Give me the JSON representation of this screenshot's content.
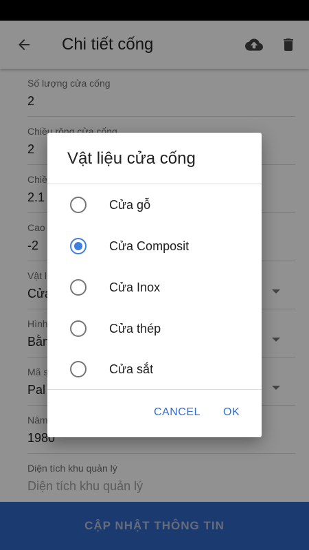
{
  "app_bar": {
    "title": "Chi tiết cống",
    "back_icon": "arrow-left-icon",
    "upload_icon": "cloud-upload-icon",
    "delete_icon": "trash-icon"
  },
  "form": {
    "fields": [
      {
        "label": "Số lượng cửa cống",
        "value": "2"
      },
      {
        "label": "Chiều rộng cửa cống",
        "value": "2"
      },
      {
        "label": "Chiều cao cửa cống",
        "value": "2.1"
      },
      {
        "label": "Cao độ đáy cống",
        "value": "-2"
      },
      {
        "label": "Vật liệu cửa cống",
        "value": "Cửa Composit"
      },
      {
        "label": "Hình thức đóng mở",
        "value": "Bằng tay"
      },
      {
        "label": "Mã số",
        "value": "Pal"
      },
      {
        "label": "Năm xây dựng",
        "value": "1980"
      },
      {
        "label": "Diện tích khu quản lý",
        "value": "Diện tích khu quản lý"
      }
    ]
  },
  "bottom_button": {
    "label": "CẬP NHẬT THÔNG TIN"
  },
  "dialog": {
    "title": "Vật liệu cửa cống",
    "options": [
      {
        "label": "Cửa gỗ",
        "checked": false
      },
      {
        "label": "Cửa Composit",
        "checked": true
      },
      {
        "label": "Cửa Inox",
        "checked": false
      },
      {
        "label": "Cửa thép",
        "checked": false
      },
      {
        "label": "Cửa sắt",
        "checked": false
      }
    ],
    "cancel_label": "CANCEL",
    "ok_label": "OK"
  },
  "colors": {
    "accent": "#3f7de0",
    "primary_button": "#2f64c0",
    "dialog_button_text": "#2f6fd6"
  }
}
